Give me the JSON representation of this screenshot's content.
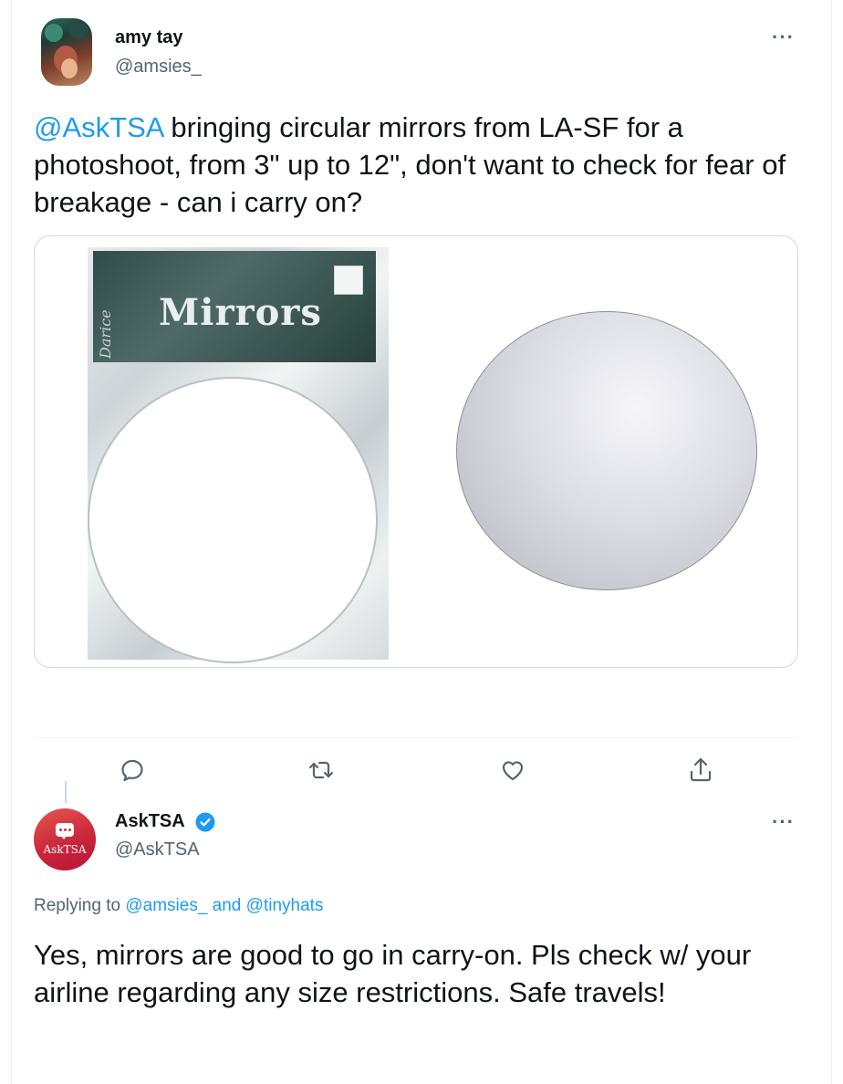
{
  "tweet1": {
    "display_name": "amy tay",
    "handle": "@amsies_",
    "more_icon": "more-dots-icon",
    "text_mention": "@AskTSA",
    "text_body": " bringing circular mirrors from LA-SF for a photoshoot, from 3\" up to 12\", don't want to check for fear of breakage - can i carry on?",
    "media": {
      "package_title": "Mirrors",
      "package_brand": "Darice"
    },
    "actions": [
      {
        "name": "reply",
        "icon": "reply-icon"
      },
      {
        "name": "retweet",
        "icon": "retweet-icon"
      },
      {
        "name": "like",
        "icon": "heart-icon"
      },
      {
        "name": "share",
        "icon": "share-icon"
      }
    ]
  },
  "tweet2": {
    "display_name": "AskTSA",
    "handle": "@AskTSA",
    "avatar_label": "AskTSA",
    "verified_icon": "verified-badge-icon",
    "replying_prefix": "Replying to ",
    "replying_user1": "@amsies_",
    "replying_and": " and ",
    "replying_user2": "@tinyhats",
    "text": "Yes, mirrors are good to go in carry-on. Pls check w/ your airline regarding any size restrictions. Safe travels!"
  },
  "colors": {
    "link": "#1d9bf0",
    "secondary_text": "#536471",
    "primary_text": "#0f1419",
    "avatar_tsa": "#c9223b"
  }
}
